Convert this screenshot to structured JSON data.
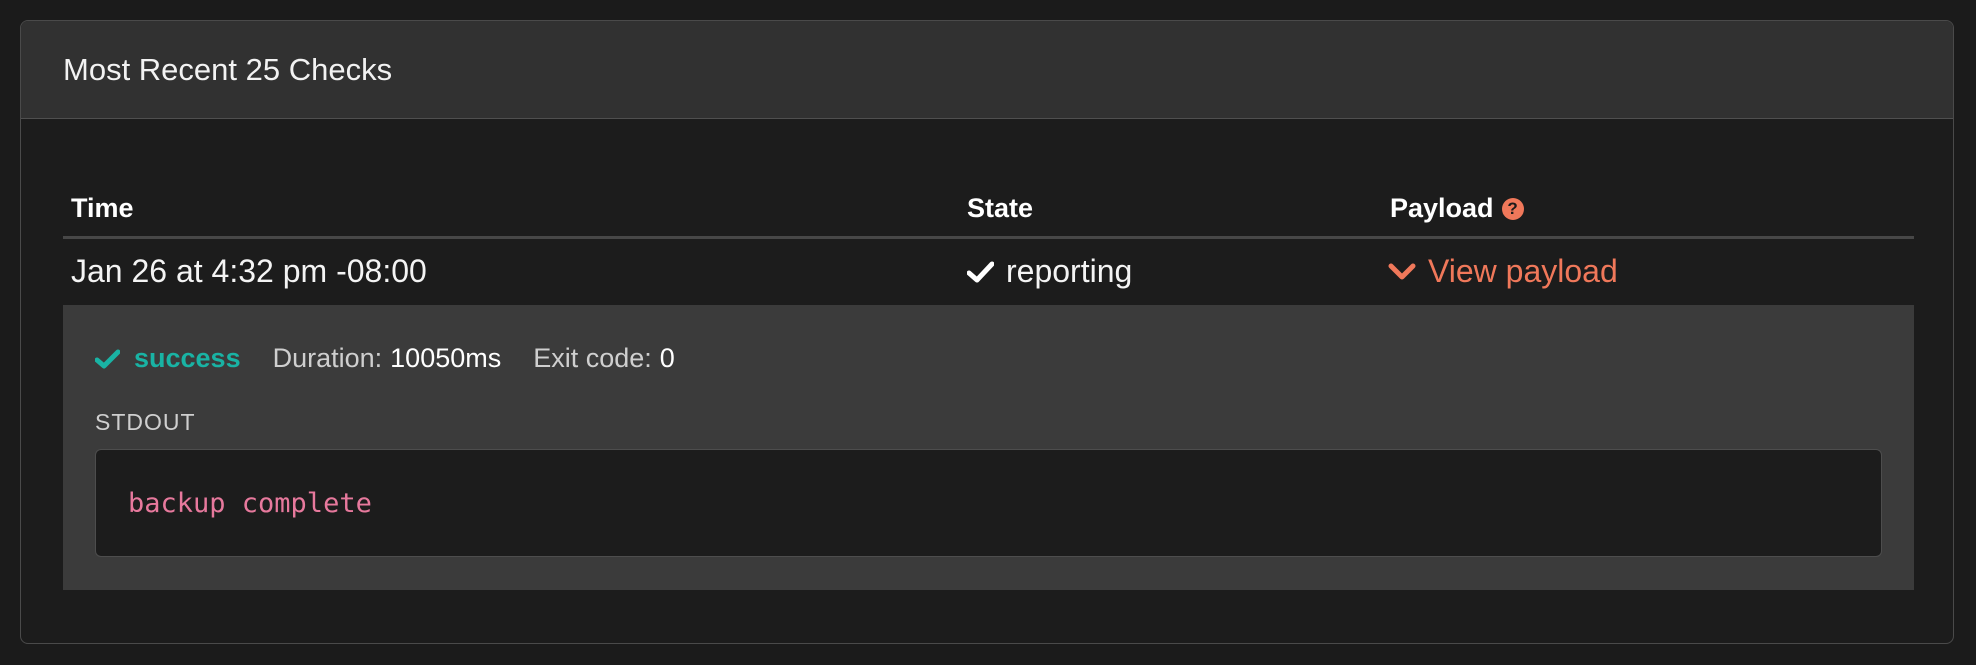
{
  "panel": {
    "title": "Most Recent 25 Checks"
  },
  "table": {
    "columns": {
      "time": "Time",
      "state": "State",
      "payload": "Payload"
    },
    "help_glyph": "?",
    "rows": [
      {
        "time": "Jan 26 at 4:32 pm -08:00",
        "state": "reporting",
        "state_icon": "check-icon",
        "payload_link": "View payload",
        "payload_icon": "chevron-down-icon"
      }
    ]
  },
  "details": {
    "status": "success",
    "status_icon": "check-icon",
    "duration_label": "Duration:",
    "duration_value": "10050ms",
    "exit_code_label": "Exit code:",
    "exit_code_value": "0",
    "stdout_label": "STDOUT",
    "stdout_text": "backup complete"
  },
  "colors": {
    "background": "#1b1b1b",
    "header_bg": "#313131",
    "accent_link": "#f0785a",
    "success": "#19b3a4",
    "stdout_text": "#e7799d",
    "details_bg": "#3b3b3b"
  }
}
